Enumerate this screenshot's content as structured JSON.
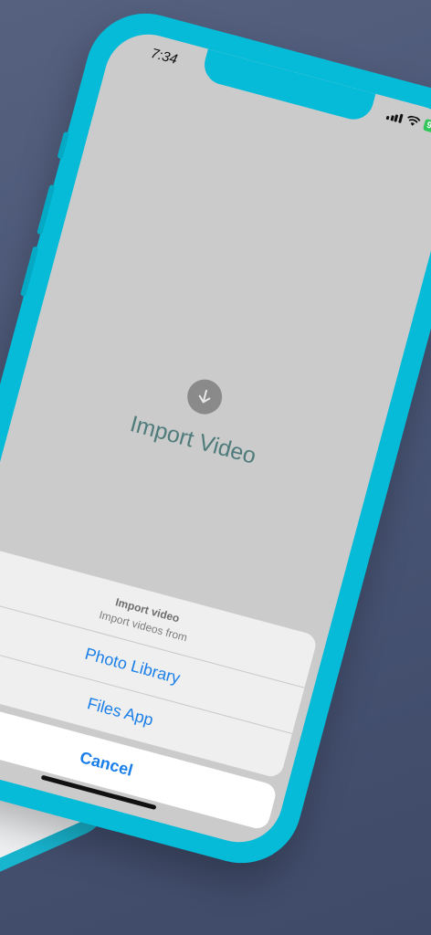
{
  "status_bar": {
    "time": "7:34",
    "battery": "96"
  },
  "main": {
    "import_title": "Import Video",
    "icon": "arrow-down-circle-icon"
  },
  "action_sheet": {
    "title": "Import video",
    "subtitle": "Import videos from",
    "options": [
      "Photo Library",
      "Files App"
    ],
    "cancel_label": "Cancel"
  },
  "colors": {
    "background": "#4a5676",
    "phone_frame": "#06bbd8",
    "accent_blue": "#1a7fe8",
    "title_teal": "#4f7b7b"
  }
}
